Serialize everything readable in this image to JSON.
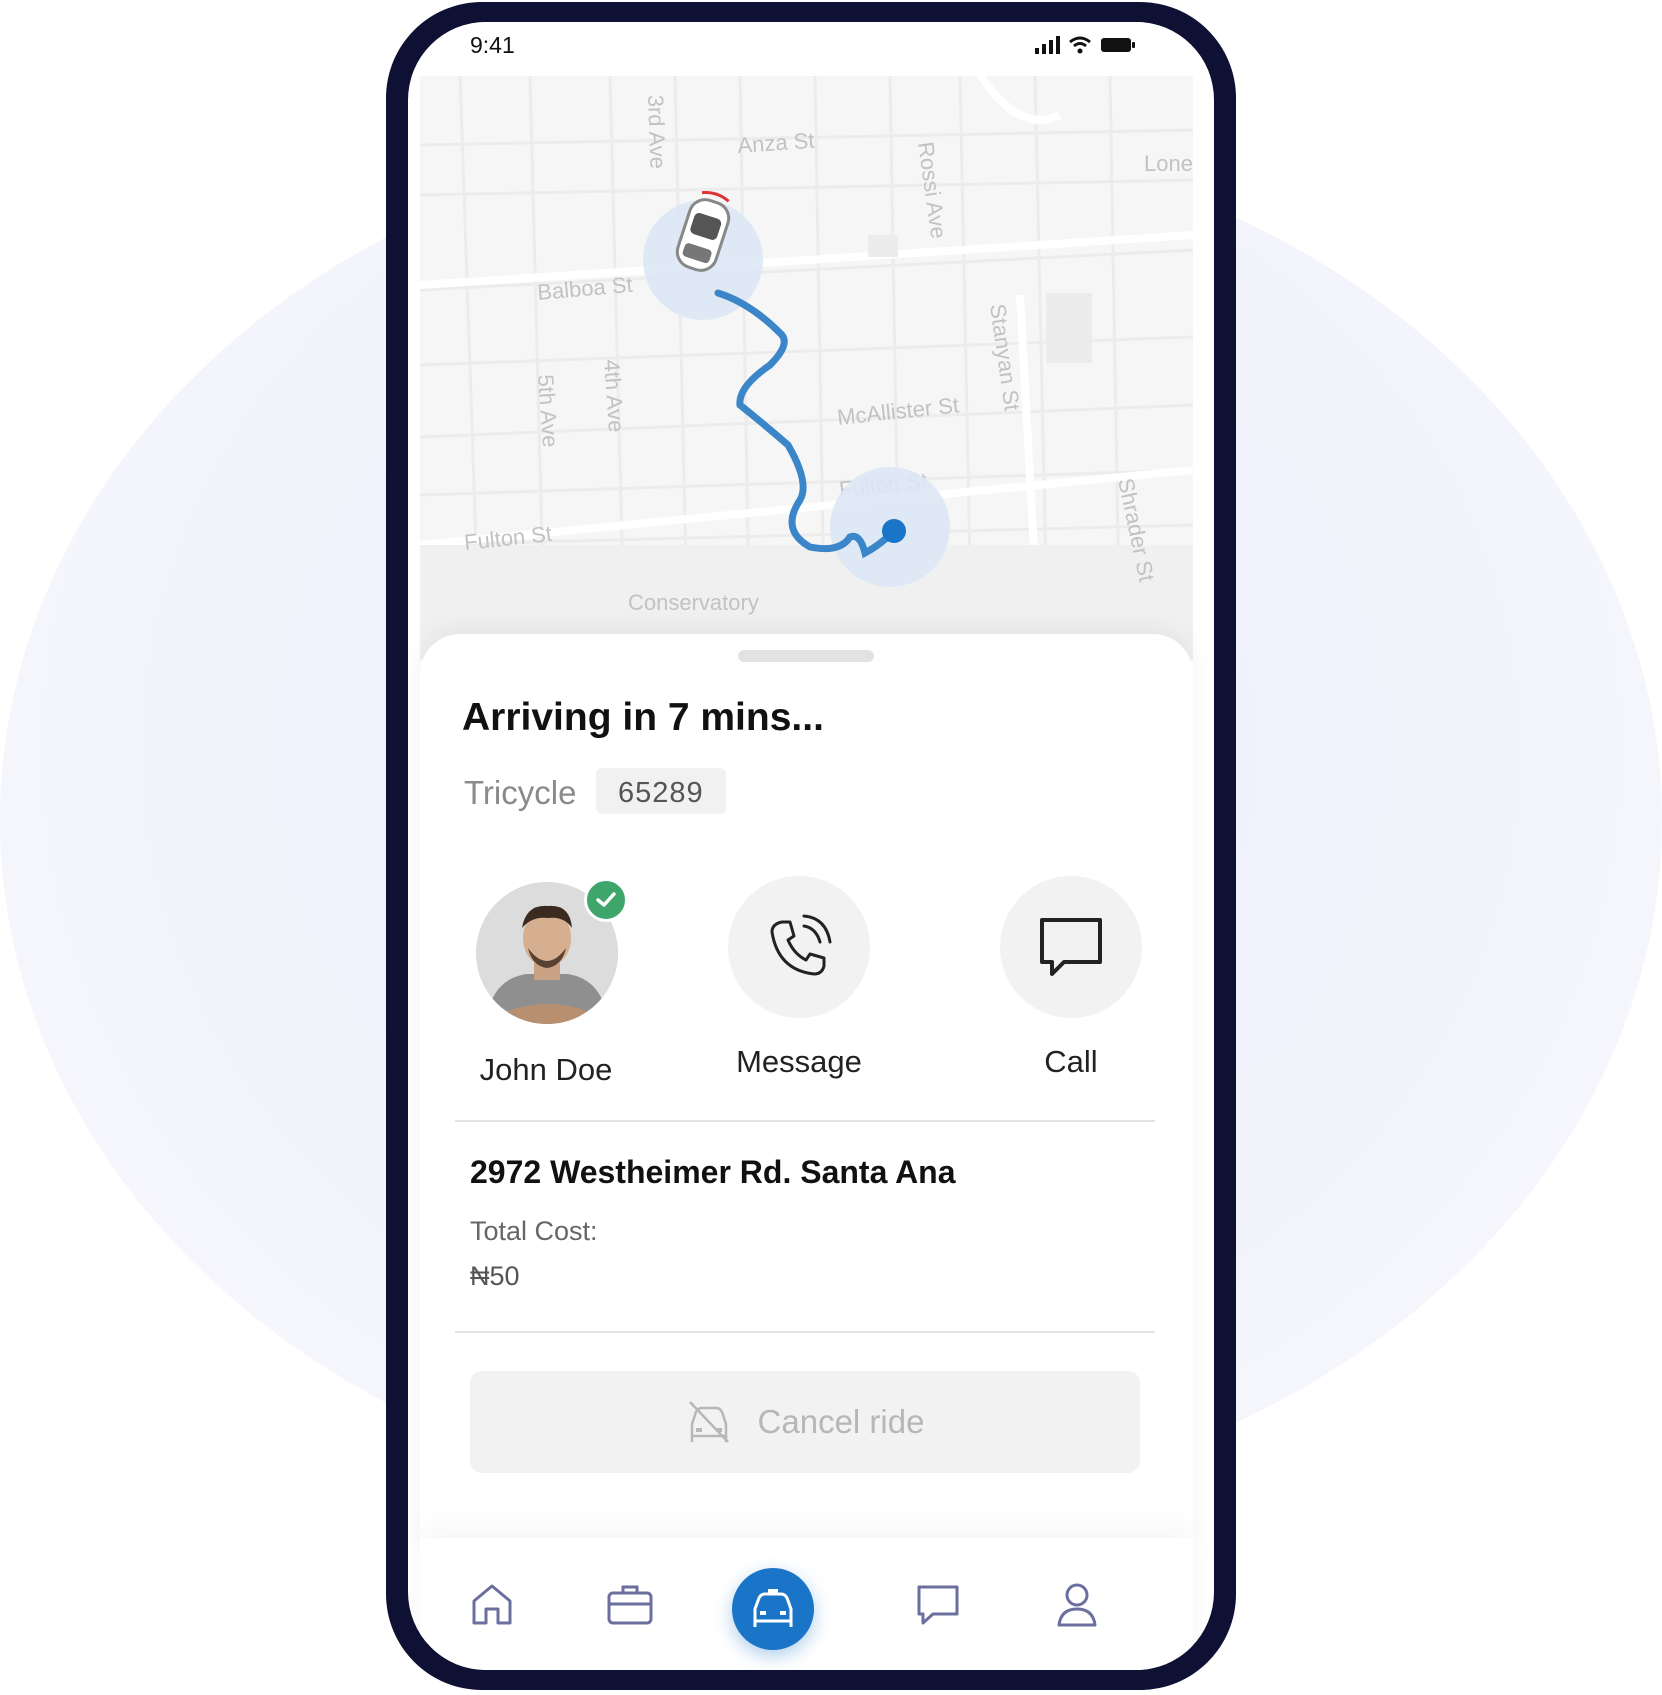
{
  "status_bar": {
    "time": "9:41"
  },
  "map": {
    "street_labels": [
      "Anza St",
      "3rd Ave",
      "Rossi Ave",
      "Lone",
      "Balboa St",
      "4th Ave",
      "5th Ave",
      "Stanyan St",
      "McAllister St",
      "Fulton St",
      "Fulton St",
      "Shrader St",
      "Conservatory"
    ],
    "route_color": "#3a86c8"
  },
  "ride": {
    "status": "Arriving in 7 mins...",
    "vehicle_type": "Tricycle",
    "plate_number": "65289"
  },
  "driver": {
    "name": "John Doe",
    "verified": true
  },
  "actions": {
    "message_label": "Message",
    "call_label": "Call"
  },
  "trip": {
    "address": "2972 Westheimer Rd. Santa Ana",
    "cost_label": "Total Cost:",
    "cost_value": "₦50"
  },
  "cancel": {
    "label": "Cancel ride"
  },
  "tabs": [
    {
      "icon": "home-icon"
    },
    {
      "icon": "briefcase-icon"
    },
    {
      "icon": "car-icon",
      "active": true
    },
    {
      "icon": "chat-icon"
    },
    {
      "icon": "user-icon"
    }
  ],
  "colors": {
    "accent": "#1a74c8",
    "verified": "#3fa66b",
    "frame": "#0e1133"
  }
}
